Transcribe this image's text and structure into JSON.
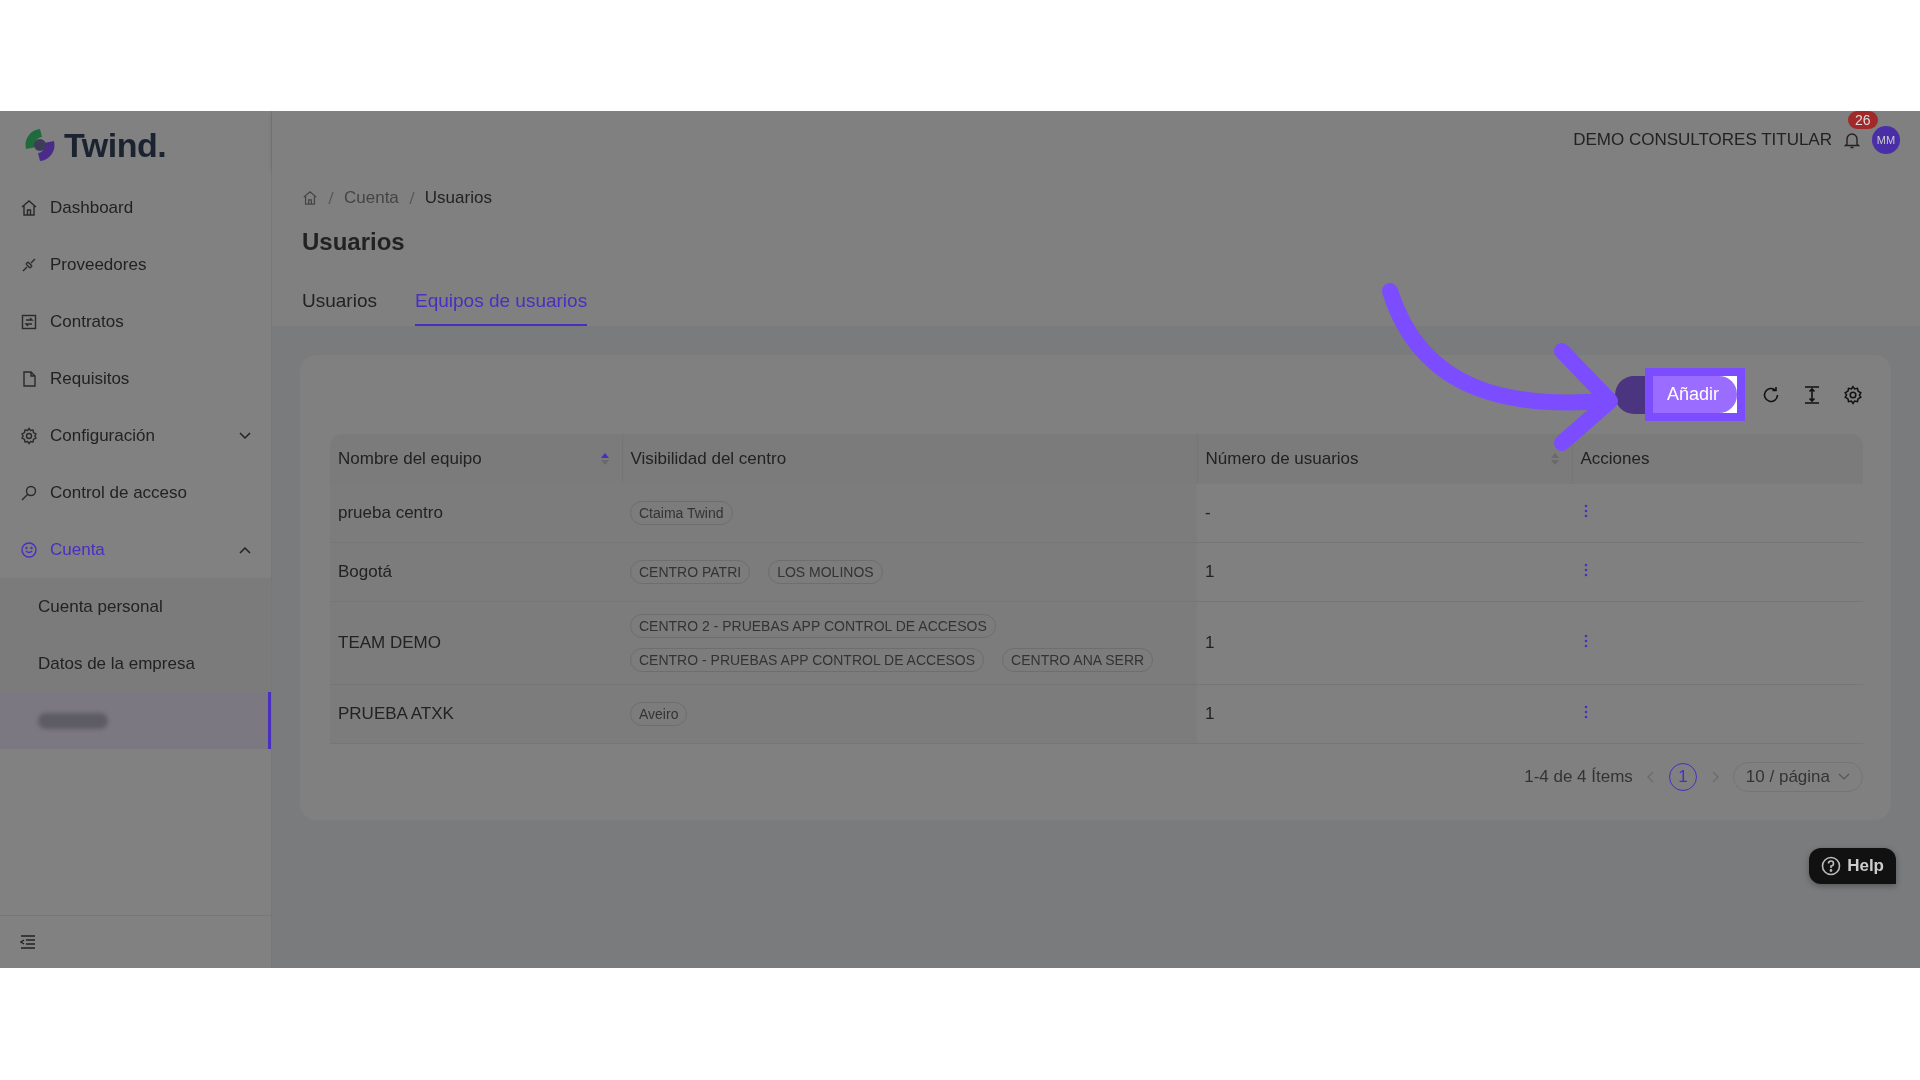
{
  "sidebar": {
    "logo": "Twind.",
    "items": [
      {
        "label": "Dashboard",
        "selected": false
      },
      {
        "label": "Proveedores",
        "selected": false
      },
      {
        "label": "Contratos",
        "selected": false
      },
      {
        "label": "Requisitos",
        "selected": false
      },
      {
        "label": "Configuración",
        "selected": false,
        "expanded": false
      },
      {
        "label": "Control de acceso",
        "selected": false
      },
      {
        "label": "Cuenta",
        "selected": true,
        "expanded": true,
        "children": [
          {
            "label": "Cuenta personal",
            "selected": false
          },
          {
            "label": "Datos de la empresa",
            "selected": false
          },
          {
            "kind": "blurred",
            "selected": true
          }
        ]
      }
    ]
  },
  "header": {
    "account": "DEMO CONSULTORES TITULAR",
    "notifications": "26",
    "avatar": "MM"
  },
  "breadcrumb": [
    "Cuenta",
    "Usuarios"
  ],
  "title": "Usuarios",
  "tabs": [
    {
      "label": "Usuarios",
      "selected": false
    },
    {
      "label": "Equipos de usuarios",
      "selected": true
    }
  ],
  "toolbar": {
    "add_button": "Añadir",
    "highlighted": true
  },
  "table": {
    "columns": [
      {
        "label": "Nombre del equipo",
        "sortable": true,
        "sorted": true
      },
      {
        "label": "Visibilidad del centro",
        "sortable": false
      },
      {
        "label": "Número de usuarios",
        "sortable": true,
        "sorted": false
      },
      {
        "label": "Acciones",
        "sortable": false
      }
    ],
    "rows": [
      {
        "name": "prueba centro",
        "centers": [
          "Ctaima Twind"
        ],
        "users": "-"
      },
      {
        "name": "Bogotá",
        "centers": [
          "CENTRO PATRI",
          "LOS MOLINOS"
        ],
        "users": "1"
      },
      {
        "name": "TEAM DEMO",
        "centers": [
          "CENTRO 2 - PRUEBAS APP CONTROL DE ACCESOS",
          "CENTRO - PRUEBAS APP CONTROL DE ACCESOS",
          "CENTRO ANA SERR"
        ],
        "users": "1"
      },
      {
        "name": "PRUEBA ATXK",
        "centers": [
          "Aveiro"
        ],
        "users": "1"
      }
    ]
  },
  "pagination": {
    "summary": "1-4 de 4 Ítems",
    "pages": [
      {
        "label": "1",
        "selected": true
      }
    ],
    "page_size": "10 / página"
  },
  "help": "Help"
}
